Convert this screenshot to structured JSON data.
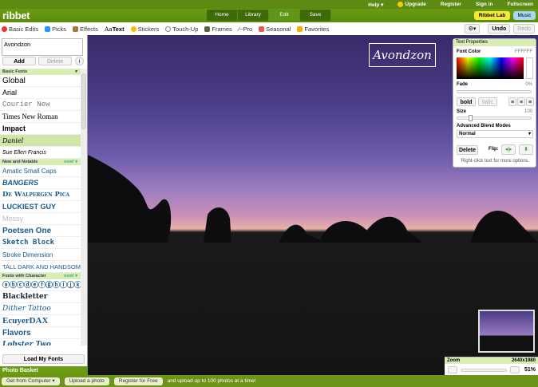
{
  "topbar": {
    "help": "Help ▾",
    "upgrade": "Upgrade",
    "register": "Register",
    "signin": "Sign in",
    "fullscreen": "Fullscreen"
  },
  "header": {
    "logo": "ribbet",
    "nav": [
      "Home",
      "Library",
      "Edit",
      "Save"
    ],
    "active": "Edit",
    "ribbet_lab": "Ribbet Lab",
    "music": "Music"
  },
  "toolbar": {
    "items": [
      "Basic Edits",
      "Picks",
      "Effects",
      "Text",
      "Stickers",
      "Touch-Up",
      "Frames",
      "Pro",
      "Seasonal",
      "Favorites"
    ],
    "active": "Text",
    "gear": "⚙▾",
    "undo": "Undo",
    "redo": "Redo"
  },
  "sidebar": {
    "text_value": "Avondzon",
    "add": "Add",
    "delete": "Delete",
    "basic_header": "Basic Fonts",
    "basic_fonts": [
      "Global",
      "Arial",
      "Courier New",
      "Times New Roman",
      "Impact",
      "Daniel",
      "Sue Ellen Francis"
    ],
    "selected_font": "Daniel",
    "notable_header": "New and Notable",
    "new_badge": "new! ▾",
    "notable_fonts": [
      "Amatic Small Caps",
      "BANGERS",
      "De Walpergen Pica",
      "LUCKIEST GUY",
      "Mossy",
      "Poetsen One",
      "Sketch Block",
      "Stroke Dimension",
      "TALL DARK AND HANDSOME"
    ],
    "character_header": "Fonts with Character",
    "character_fonts": [
      "ⓐⓑⓒⓓⓔⓕⓖⓗⓘⓙⓚ",
      "Blackletter",
      "Dither Tattoo",
      "EcuyerDAX",
      "Flavors",
      "Lobster Two"
    ],
    "load_fonts": "Load My Fonts"
  },
  "canvas": {
    "text": "Avondzon"
  },
  "text_properties": {
    "title": "Text Properties",
    "font_color_label": "Font Color",
    "font_color": "FFFFFF",
    "fade_label": "Fade",
    "fade": "0%",
    "bold": "bold",
    "italic": "italic",
    "size_label": "Size",
    "size": "100",
    "blend_label": "Advanced Blend Modes",
    "blend": "Normal",
    "delete": "Delete",
    "flip": "Flip:",
    "hint": "Right-click text for more options."
  },
  "zoom": {
    "label": "Zoom",
    "dimensions": "2640x1980",
    "value": "51%"
  },
  "basket": {
    "title": "Photo Basket",
    "get": "Get from Computer ▾",
    "upload": "Upload a photo",
    "register": "Register for Free",
    "note": "and upload up to 100 photos at a time!"
  },
  "colors": {
    "brand_green": "#6a9c12",
    "lab_yellow": "#f5e933",
    "music_blue": "#a7d7f5"
  }
}
